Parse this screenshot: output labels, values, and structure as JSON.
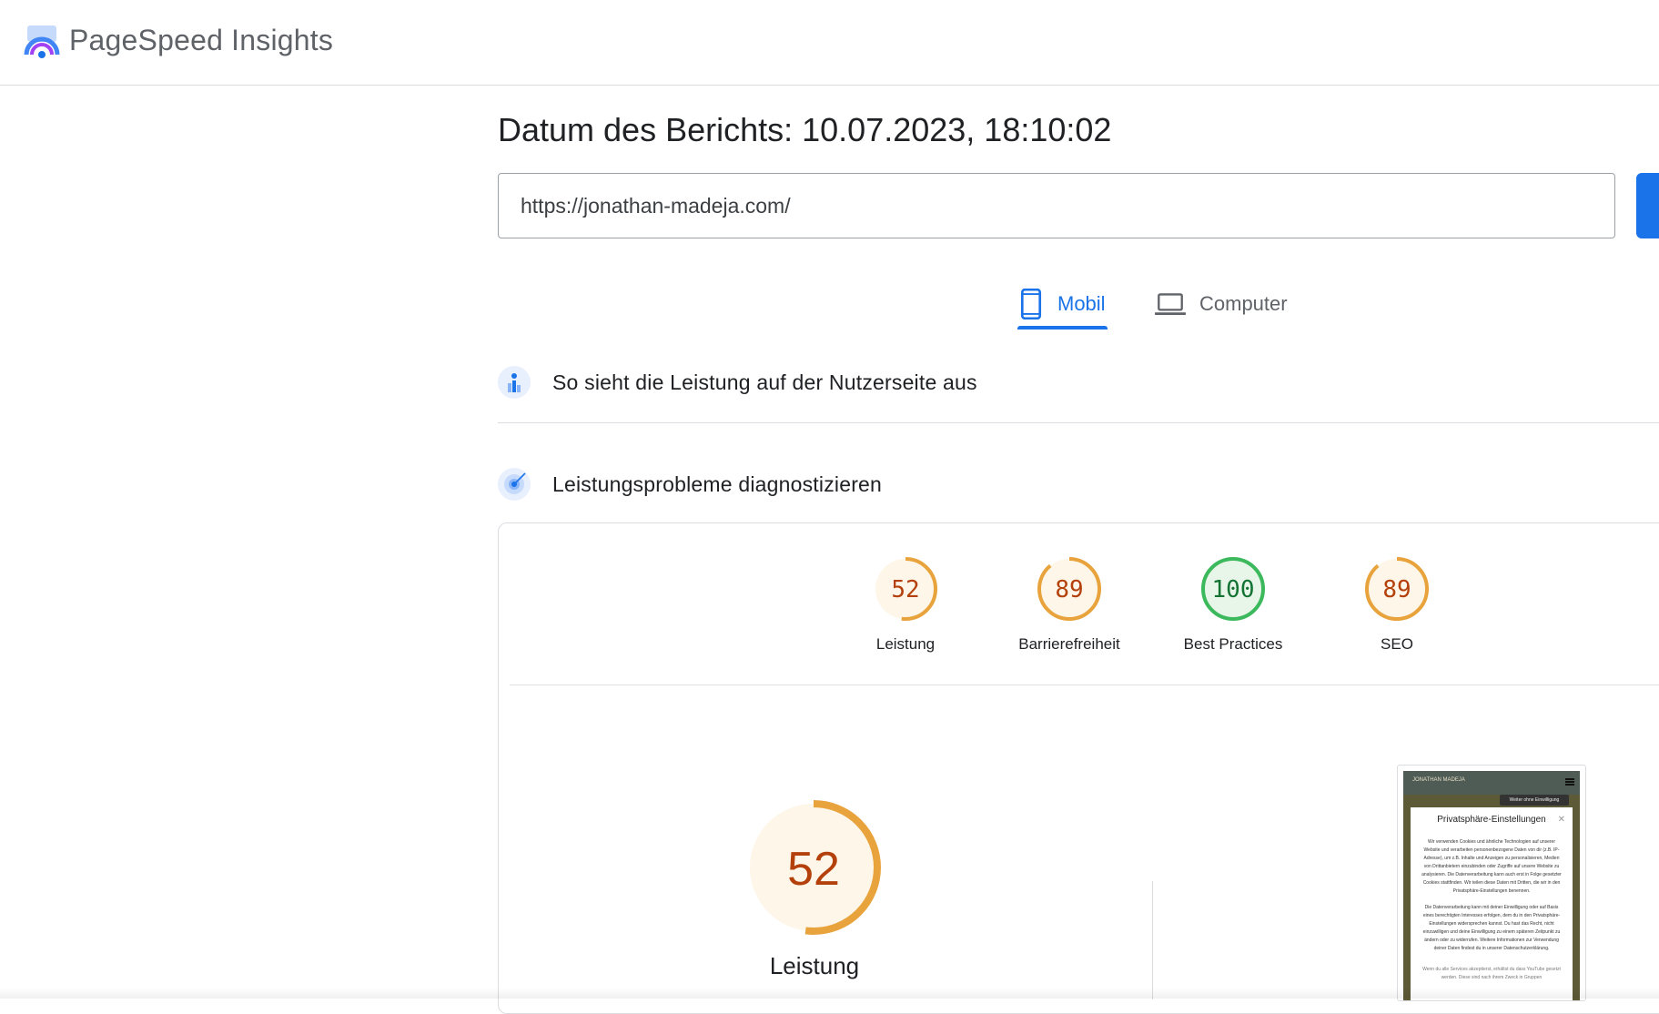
{
  "app": {
    "name": "PageSpeed Insights"
  },
  "report": {
    "date_label": "Datum des Berichts: 10.07.2023, 18:10:02"
  },
  "url_input": {
    "value": "https://jonathan-madeja.com/"
  },
  "tabs": [
    {
      "label": "Mobil",
      "icon": "smartphone-icon",
      "selected": true
    },
    {
      "label": "Computer",
      "icon": "laptop-icon",
      "selected": false
    }
  ],
  "sections": {
    "field_data": {
      "title": "So sieht die Leistung auf der Nutzerseite aus",
      "icon": "users-chart-icon"
    },
    "diagnose": {
      "title": "Leistungsprobleme diagnostizieren",
      "icon": "lab-radar-icon"
    }
  },
  "scores": [
    {
      "label": "Leistung",
      "value": 52,
      "status": "average"
    },
    {
      "label": "Barrierefreiheit",
      "value": 89,
      "status": "average"
    },
    {
      "label": "Best Practices",
      "value": 100,
      "status": "pass"
    },
    {
      "label": "SEO",
      "value": 89,
      "status": "average"
    }
  ],
  "main_score": {
    "label": "Leistung",
    "value": 52
  },
  "screenshot": {
    "site_name": "JONATHAN MADEJA",
    "tooltip": "Weiter ohne Einwilligung",
    "dialog_title": "Privatsphäre-Einstellungen",
    "dialog_text_1": "Wir verwenden Cookies und ähnliche Technologien auf unserer Website und verarbeiten personenbezogene Daten von dir (z.B. IP-Adresse), um z.B. Inhalte und Anzeigen zu personalisieren, Medien von Drittanbietern einzubinden oder Zugriffe auf unsere Website zu analysieren. Die Datenverarbeitung kann auch erst in Folge gesetzter Cookies stattfinden. Wir teilen diese Daten mit Dritten, die wir in den Privatsphäre-Einstellungen benennen.",
    "dialog_text_2": "Die Datenverarbeitung kann mit deiner Einwilligung oder auf Basis eines berechtigten Interesses erfolgen, dem du in den Privatsphäre-Einstellungen widersprechen kannst. Du hast das Recht, nicht einzuwilligen und deine Einwilligung zu einem späteren Zeitpunkt zu ändern oder zu widerrufen. Weitere Informationen zur Verwendung deiner Daten findest du in unserer Datenschutzerklärung.",
    "dialog_text_3": "Wenn du alle Services akzeptierst, erhältst du dass YouTube gesetzt werden. Diese sind nach ihrem Zweck in Gruppen"
  },
  "colors": {
    "primary": "#1a73e8",
    "average": "#e8a33d",
    "average_text": "#b4410c",
    "average_fill": "#fef6e8",
    "pass": "#3cb95c",
    "pass_text": "#137333",
    "pass_fill": "#e8f5e9"
  }
}
